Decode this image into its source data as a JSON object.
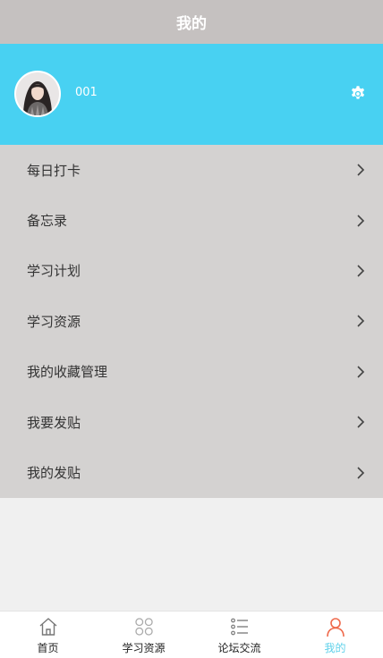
{
  "header": {
    "title": "我的"
  },
  "profile": {
    "username": "001",
    "avatar_icon": "user-avatar-photo",
    "settings_icon": "gear-icon",
    "accent_color": "#48d1f2"
  },
  "menu": {
    "items": [
      {
        "label": "每日打卡"
      },
      {
        "label": "备忘录"
      },
      {
        "label": "学习计划"
      },
      {
        "label": "学习资源"
      },
      {
        "label": "我的收藏管理"
      },
      {
        "label": "我要发贴"
      },
      {
        "label": "我的发贴"
      }
    ],
    "chevron_icon": "chevron-right-icon"
  },
  "tabbar": {
    "tabs": [
      {
        "label": "首页",
        "icon": "home-icon"
      },
      {
        "label": "学习资源",
        "icon": "grid-icon"
      },
      {
        "label": "论坛交流",
        "icon": "list-icon"
      },
      {
        "label": "我的",
        "icon": "user-icon",
        "active": true
      }
    ],
    "active_color": "#5fd1ea"
  }
}
